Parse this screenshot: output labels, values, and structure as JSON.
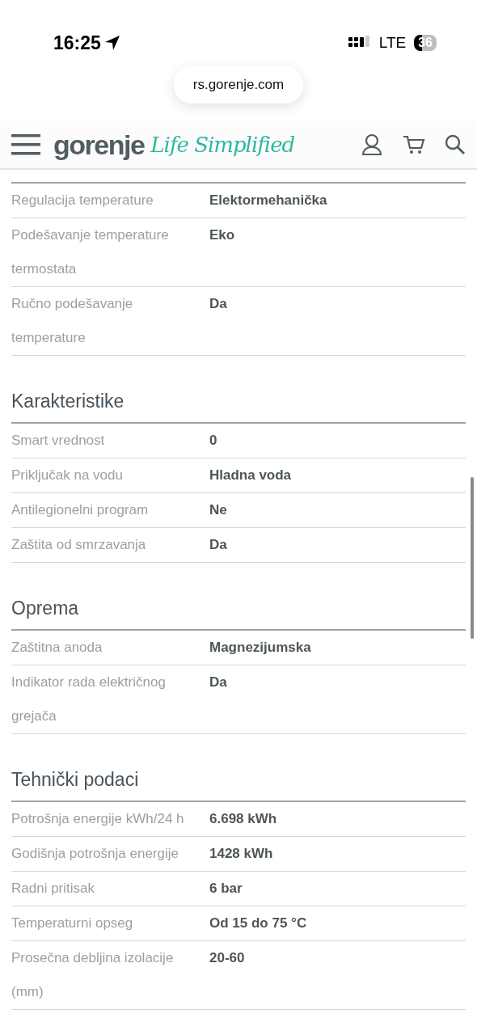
{
  "status_bar": {
    "time": "16:25",
    "network": "LTE",
    "battery": "36"
  },
  "address_bar": {
    "url": "rs.gorenje.com"
  },
  "header": {
    "brand": "gorenje",
    "tagline": "Life Simplified"
  },
  "sections": [
    {
      "rows": [
        {
          "label": "Regulacija temperature",
          "value": "Elektormehanička"
        },
        {
          "label": "Podešavanje temperature termostata",
          "value": "Eko"
        },
        {
          "label": "Ručno podešavanje temperature",
          "value": "Da"
        }
      ]
    },
    {
      "title": "Karakteristike",
      "rows": [
        {
          "label": "Smart vrednost",
          "value": "0"
        },
        {
          "label": "Priključak na vodu",
          "value": "Hladna voda"
        },
        {
          "label": "Antilegionelni program",
          "value": "Ne"
        },
        {
          "label": "Zaštita od smrzavanja",
          "value": "Da"
        }
      ]
    },
    {
      "title": "Oprema",
      "rows": [
        {
          "label": "Zaštitna anoda",
          "value": "Magnezijumska"
        },
        {
          "label": "Indikator rada električnog grejača",
          "value": "Da"
        }
      ]
    },
    {
      "title": "Tehnički podaci",
      "rows": [
        {
          "label": "Potrošnja energije kWh/24 h",
          "value": "6.698 kWh"
        },
        {
          "label": "Godišnja potrošnja energije",
          "value": "1428 kWh"
        },
        {
          "label": "Radni pritisak",
          "value": "6 bar"
        },
        {
          "label": "Temperaturni opseg",
          "value": "Od 15 do 75 °C"
        },
        {
          "label": "Prosečna debljina izolacije (mm)",
          "value": "20-60"
        }
      ]
    }
  ]
}
